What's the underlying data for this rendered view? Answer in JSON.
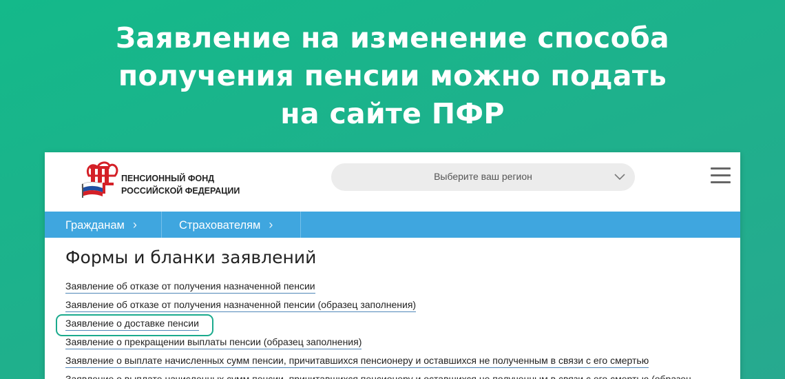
{
  "headline": {
    "line1": "Заявление на изменение способа",
    "line2": "получения пенсии можно подать",
    "line3": "на сайте ПФР"
  },
  "header": {
    "org_name_line1": "ПЕНСИОННЫЙ ФОНД",
    "org_name_line2": "РОССИЙСКОЙ ФЕДЕРАЦИИ",
    "region_placeholder": "Выберите ваш регион"
  },
  "nav": {
    "items": [
      {
        "label": "Гражданам"
      },
      {
        "label": "Страхователям"
      }
    ]
  },
  "page": {
    "title": "Формы и бланки заявлений",
    "links": [
      "Заявление об отказе от получения назначенной пенсии",
      "Заявление об отказе от получения назначенной пенсии (образец заполнения)",
      "Заявление о доставке пенсии",
      "Заявление о прекращении выплаты пенсии (образец заполнения)",
      "Заявление о выплате начисленных сумм пенсии, причитавшихся пенсионеру и оставшихся не полученным в связи с его смертью",
      "Заявление о выплате начисленных сумм пенсии, причитавшихся пенсионеру и оставшихся не полученным в связи с его смертью (образец"
    ],
    "highlighted_link": "Заявление о доставке пенсии"
  },
  "colors": {
    "background": "#1fb08c",
    "nav_bar": "#3fa6df",
    "highlight_border": "#1aaa8d",
    "link_underline": "#4f86b8"
  },
  "icons": {
    "logo": "pfr-logo",
    "region_dropdown": "chevron-down-icon",
    "menu": "hamburger-menu-icon",
    "nav_chevron": "chevron-right-icon"
  }
}
